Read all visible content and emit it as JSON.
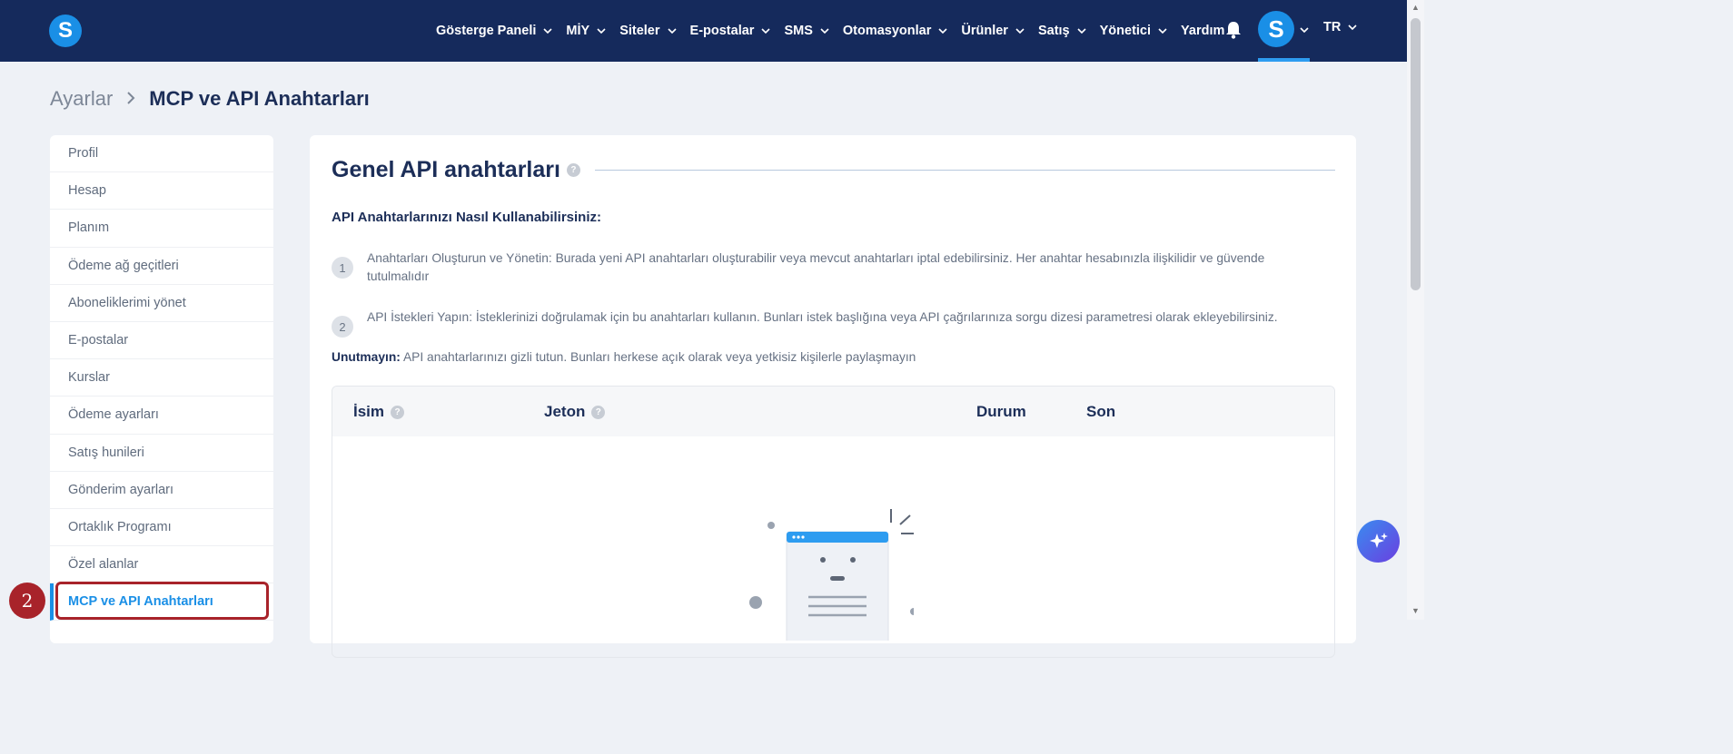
{
  "nav": {
    "items": [
      {
        "label": "Gösterge Paneli",
        "dropdown": true
      },
      {
        "label": "MİY",
        "dropdown": true
      },
      {
        "label": "Siteler",
        "dropdown": true
      },
      {
        "label": "E-postalar",
        "dropdown": true
      },
      {
        "label": "SMS",
        "dropdown": true
      },
      {
        "label": "Otomasyonlar",
        "dropdown": true
      },
      {
        "label": "Ürünler",
        "dropdown": true
      },
      {
        "label": "Satış",
        "dropdown": true
      },
      {
        "label": "Yönetici",
        "dropdown": true
      },
      {
        "label": "Yardım",
        "dropdown": false
      }
    ],
    "logo_letter": "S",
    "avatar_letter": "S",
    "language": "TR"
  },
  "breadcrumb": {
    "parent": "Ayarlar",
    "current": "MCP ve API Anahtarları"
  },
  "sidebar": {
    "items": [
      {
        "label": "Profil"
      },
      {
        "label": "Hesap"
      },
      {
        "label": "Planım"
      },
      {
        "label": "Ödeme ağ geçitleri"
      },
      {
        "label": "Aboneliklerimi yönet"
      },
      {
        "label": "E-postalar"
      },
      {
        "label": "Kurslar"
      },
      {
        "label": "Ödeme ayarları"
      },
      {
        "label": "Satış hunileri"
      },
      {
        "label": "Gönderim ayarları"
      },
      {
        "label": "Ortaklık Programı"
      },
      {
        "label": "Özel alanlar"
      },
      {
        "label": "MCP ve API Anahtarları",
        "active": true
      }
    ]
  },
  "annotation": {
    "step": "2"
  },
  "main": {
    "title": "Genel API anahtarları",
    "howto_title": "API Anahtarlarınızı Nasıl Kullanabilirsiniz:",
    "steps": [
      {
        "num": "1",
        "text": "Anahtarları Oluşturun ve Yönetin: Burada yeni API anahtarları oluşturabilir veya mevcut anahtarları iptal edebilirsiniz. Her anahtar hesabınızla ilişkilidir ve güvende tutulmalıdır"
      },
      {
        "num": "2",
        "text": "API İstekleri Yapın: İsteklerinizi doğrulamak için bu anahtarları kullanın. Bunları istek başlığına veya API çağrılarınıza sorgu dizesi parametresi olarak ekleyebilirsiniz."
      }
    ],
    "note_bold": "Unutmayın:",
    "note_text": " API anahtarlarınızı gizli tutun. Bunları herkese açık olarak veya yetkisiz kişilerle paylaşmayın",
    "table": {
      "columns": [
        "İsim",
        "Jeton",
        "Durum",
        "Son"
      ]
    }
  },
  "colors": {
    "nav_bg": "#152a5c",
    "accent": "#1a8fe6",
    "annotation": "#a8232a"
  }
}
